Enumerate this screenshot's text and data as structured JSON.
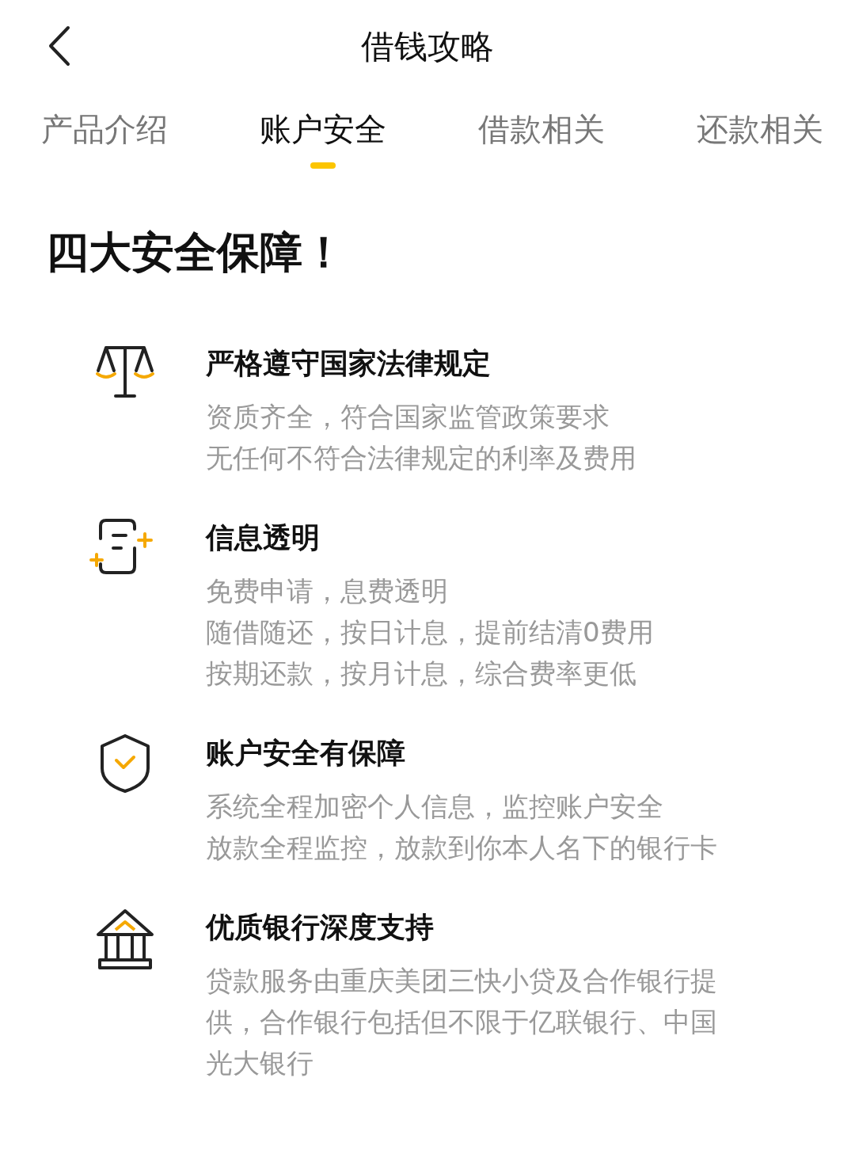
{
  "nav": {
    "title": "借钱攻略"
  },
  "tabs": [
    {
      "label": "产品介绍",
      "selected": false
    },
    {
      "label": "账户安全",
      "selected": true
    },
    {
      "label": "借款相关",
      "selected": false
    },
    {
      "label": "还款相关",
      "selected": false
    }
  ],
  "heading": "四大安全保障！",
  "sections": [
    {
      "title": "严格遵守国家法律规定",
      "lines": [
        "资质齐全，符合国家监管政策要求",
        "无任何不符合法律规定的利率及费用"
      ]
    },
    {
      "title": "信息透明",
      "lines": [
        "免费申请，息费透明",
        "随借随还，按日计息，提前结清0费用",
        "按期还款，按月计息，综合费率更低"
      ]
    },
    {
      "title": "账户安全有保障",
      "lines": [
        "系统全程加密个人信息，监控账户安全",
        "放款全程监控，放款到你本人名下的银行卡"
      ]
    },
    {
      "title": "优质银行深度支持",
      "lines": [
        "贷款服务由重庆美团三快小贷及合作银行提供，合作银行包括但不限于亿联银行、中国光大银行"
      ]
    }
  ]
}
